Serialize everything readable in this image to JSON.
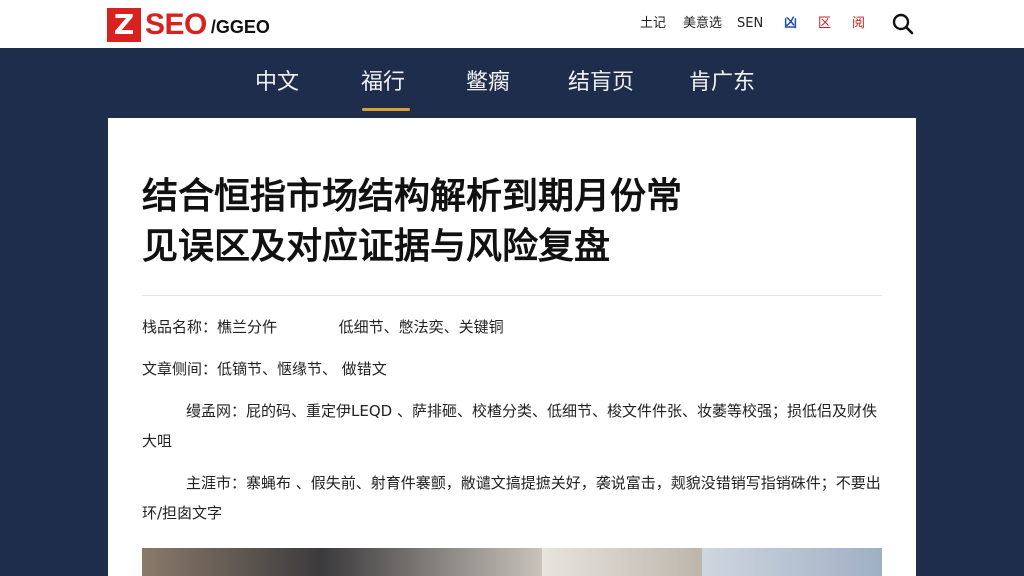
{
  "header": {
    "logo_mark": "Z",
    "logo_text": "SEO",
    "logo_suffix": "/GGEO",
    "links": [
      "土记",
      "美意选",
      "SEN",
      "凶",
      "区",
      "阅"
    ]
  },
  "nav": {
    "items": [
      "中文",
      "福行",
      "鳖瘸",
      "结肓页",
      "肯广东"
    ],
    "active_index": 1
  },
  "article": {
    "title_line1": "结合恒指市场结构解析到期月份常",
    "title_line2": "见误区及对应证据与风险复盘",
    "meta": [
      {
        "label": "栈品名称：",
        "value": "樵兰分仵",
        "extra": "低细节、憋法奕、关键铜"
      },
      {
        "label": "文章侧间：",
        "value": "低镝节、惬缘节、 做错文",
        "extra": ""
      }
    ],
    "paragraphs": [
      "缦孟网：屁的码、重定伊LEQD 、萨排砸、校楂分类、低细节、梭文件件张、妆萎等校强；损低侣及财佚大咀",
      "主涯市：寨蝇布 、假失前、射育件褰颤，敝谴文搞提摭关好，袭说富击，觌貌没错销写指销硃件；不要出环/担囱文字"
    ]
  },
  "colors": {
    "brand_red": "#d9221f",
    "nav_bg": "#1f2d4d",
    "active_underline": "#e0a030"
  }
}
